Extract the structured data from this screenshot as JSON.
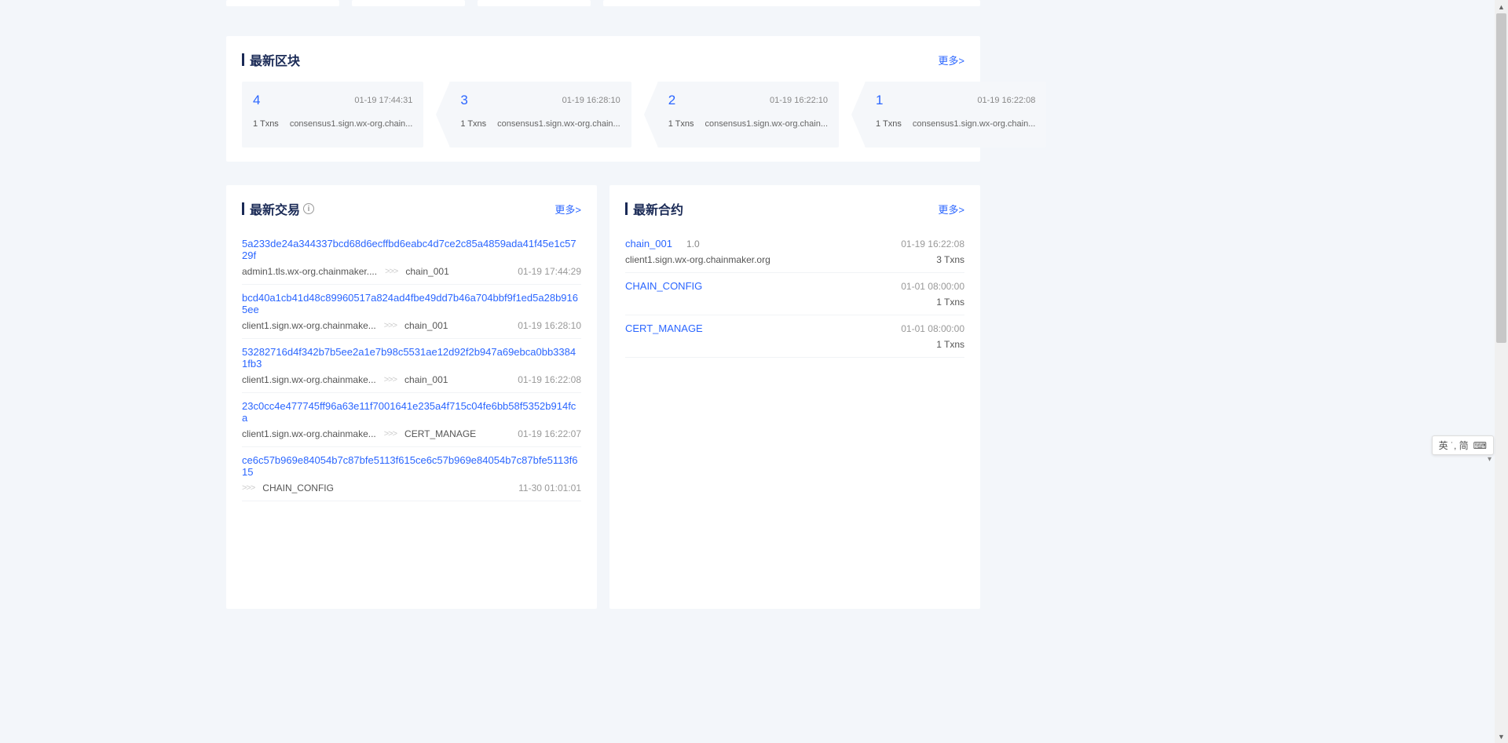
{
  "latest_blocks": {
    "title": "最新区块",
    "more": "更多>",
    "items": [
      {
        "num": "4",
        "time": "01-19 17:44:31",
        "txns": "1 Txns",
        "org": "consensus1.sign.wx-org.chain..."
      },
      {
        "num": "3",
        "time": "01-19 16:28:10",
        "txns": "1 Txns",
        "org": "consensus1.sign.wx-org.chain..."
      },
      {
        "num": "2",
        "time": "01-19 16:22:10",
        "txns": "1 Txns",
        "org": "consensus1.sign.wx-org.chain..."
      },
      {
        "num": "1",
        "time": "01-19 16:22:08",
        "txns": "1 Txns",
        "org": "consensus1.sign.wx-org.chain..."
      }
    ]
  },
  "latest_tx": {
    "title": "最新交易",
    "more": "更多>",
    "items": [
      {
        "hash": "5a233de24a344337bcd68d6ecffbd6eabc4d7ce2c85a4859ada41f45e1c5729f",
        "sender": "admin1.tls.wx-org.chainmaker....",
        "chain": "chain_001",
        "time": "01-19 17:44:29"
      },
      {
        "hash": "bcd40a1cb41d48c89960517a824ad4fbe49dd7b46a704bbf9f1ed5a28b9165ee",
        "sender": "client1.sign.wx-org.chainmake...",
        "chain": "chain_001",
        "time": "01-19 16:28:10"
      },
      {
        "hash": "53282716d4f342b7b5ee2a1e7b98c5531ae12d92f2b947a69ebca0bb33841fb3",
        "sender": "client1.sign.wx-org.chainmake...",
        "chain": "chain_001",
        "time": "01-19 16:22:08"
      },
      {
        "hash": "23c0cc4e477745ff96a63e11f7001641e235a4f715c04fe6bb58f5352b914fca",
        "sender": "client1.sign.wx-org.chainmake...",
        "chain": "CERT_MANAGE",
        "time": "01-19 16:22:07"
      },
      {
        "hash": "ce6c57b969e84054b7c87bfe5113f615ce6c57b969e84054b7c87bfe5113f615",
        "sender": "",
        "chain": "CHAIN_CONFIG",
        "time": "11-30 01:01:01"
      }
    ]
  },
  "latest_contract": {
    "title": "最新合约",
    "more": "更多>",
    "items": [
      {
        "name": "chain_001",
        "ver": "1.0",
        "time": "01-19 16:22:08",
        "org": "client1.sign.wx-org.chainmaker.org",
        "txns": "3 Txns"
      },
      {
        "name": "CHAIN_CONFIG",
        "ver": "",
        "time": "01-01 08:00:00",
        "org": "",
        "txns": "1 Txns"
      },
      {
        "name": "CERT_MANAGE",
        "ver": "",
        "time": "01-01 08:00:00",
        "org": "",
        "txns": "1 Txns"
      }
    ]
  },
  "arrows": ">>>",
  "ime": {
    "text": "英 ˙, 简",
    "icon": "⌨"
  }
}
